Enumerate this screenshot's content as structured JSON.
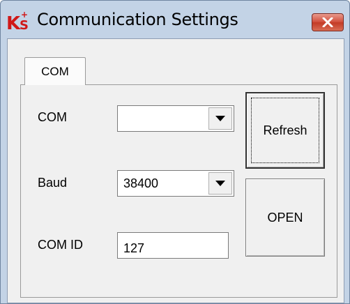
{
  "window": {
    "title": "Communication Settings",
    "icon": "ks-app-icon",
    "close_icon": "close-icon"
  },
  "tabs": [
    {
      "label": "COM",
      "active": true
    }
  ],
  "form": {
    "com": {
      "label": "COM",
      "value": ""
    },
    "baud": {
      "label": "Baud",
      "value": "38400"
    },
    "com_id": {
      "label": "COM ID",
      "value": "127"
    }
  },
  "buttons": {
    "refresh": "Refresh",
    "open": "OPEN"
  },
  "colors": {
    "titlebar": "#c3d3e6",
    "close_button": "#c9432e",
    "client_bg": "#f0f0f0",
    "logo_red": "#d01818"
  }
}
